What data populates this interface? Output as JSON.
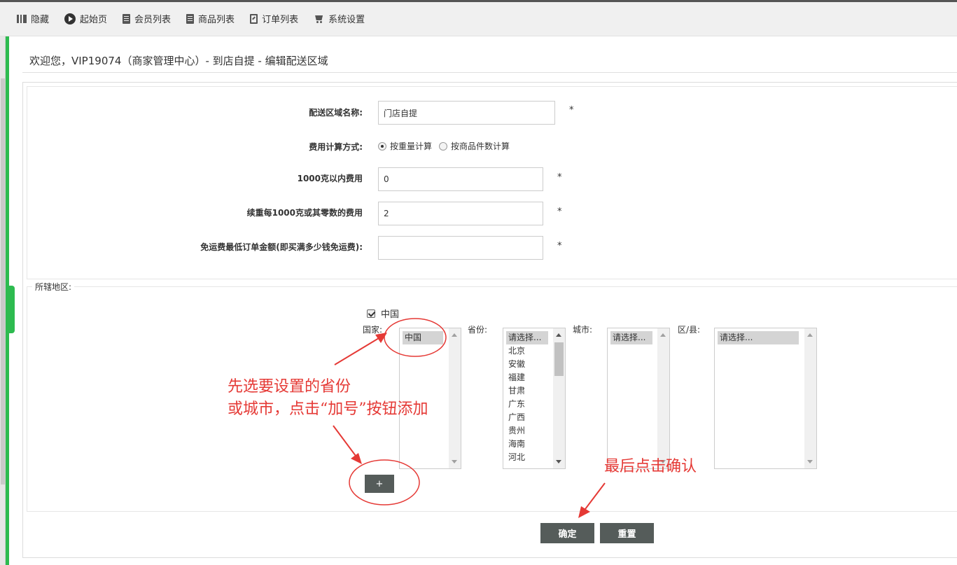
{
  "nav": {
    "items": [
      {
        "label": "隐藏",
        "icon": "hide-icon"
      },
      {
        "label": "起始页",
        "icon": "play-icon"
      },
      {
        "label": "会员列表",
        "icon": "document-icon"
      },
      {
        "label": "商品列表",
        "icon": "document-icon"
      },
      {
        "label": "订单列表",
        "icon": "edit-icon"
      },
      {
        "label": "系统设置",
        "icon": "cart-icon"
      }
    ]
  },
  "header": {
    "welcome": "欢迎您，VIP19074（商家管理中心）- 到店自提 - 编辑配送区域"
  },
  "form": {
    "area_name": {
      "label": "配送区域名称:",
      "value": "门店自提",
      "required": "*"
    },
    "fee_method": {
      "label": "费用计算方式:",
      "options": [
        {
          "label": "按重量计算",
          "checked": true
        },
        {
          "label": "按商品件数计算",
          "checked": false
        }
      ]
    },
    "base_fee": {
      "label": "1000克以内费用",
      "value": "0",
      "required": "*"
    },
    "extra_fee": {
      "label": "续重每1000克或其零数的费用",
      "value": "2",
      "required": "*"
    },
    "free_min": {
      "label": "免运费最低订单金额(即买满多少钱免运费):",
      "value": "",
      "required": "*"
    }
  },
  "region": {
    "legend": "所辖地区:",
    "checked_country": {
      "label": "中国",
      "checked": true
    },
    "country": {
      "label": "国家:",
      "options": [
        "中国"
      ],
      "selected": "中国"
    },
    "province": {
      "label": "省份:",
      "options": [
        "请选择...",
        "北京",
        "安徽",
        "福建",
        "甘肃",
        "广东",
        "广西",
        "贵州",
        "海南",
        "河北"
      ],
      "selected": "请选择..."
    },
    "city": {
      "label": "城市:",
      "options": [
        "请选择..."
      ],
      "selected": "请选择..."
    },
    "district": {
      "label": "区/县:",
      "options": [
        "请选择..."
      ],
      "selected": "请选择..."
    },
    "add_label": "+"
  },
  "actions": {
    "confirm": "确定",
    "reset": "重置"
  },
  "annotations": {
    "step1_line1": "先选要设置的省份",
    "step1_line2": "或城市，点击“加号”按钮添加",
    "step2": "最后点击确认",
    "color": "#e53935"
  }
}
